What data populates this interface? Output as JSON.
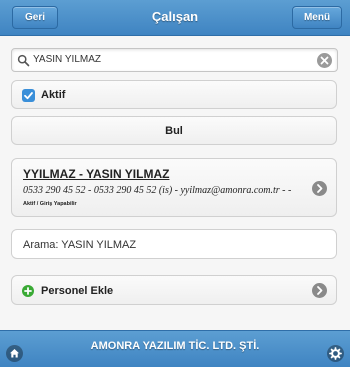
{
  "header": {
    "title": "Çalışan",
    "back_label": "Geri",
    "menu_label": "Menü"
  },
  "search": {
    "value": "YASIN YILMAZ",
    "icon": "search-icon",
    "clear_icon": "clear-icon"
  },
  "filter": {
    "label": "Aktif",
    "checked": true
  },
  "find_button": {
    "label": "Bul"
  },
  "result": {
    "title": "YYILMAZ - YASIN YILMAZ",
    "details": "0533 290 45 52 - 0533 290 45 52 (is) - yyilmaz@amonra.com.tr - -",
    "status": "Aktif / Giriş Yapabilir"
  },
  "search_summary": {
    "text": "Arama: YASIN YILMAZ"
  },
  "add_button": {
    "label": "Personel Ekle"
  },
  "footer": {
    "text": "AMONRA YAZILIM TİC. LTD. ŞTİ."
  },
  "colors": {
    "header_blue": "#3f84c2",
    "checkbox_blue": "#3a8fd9",
    "add_green": "#3aaa35"
  }
}
